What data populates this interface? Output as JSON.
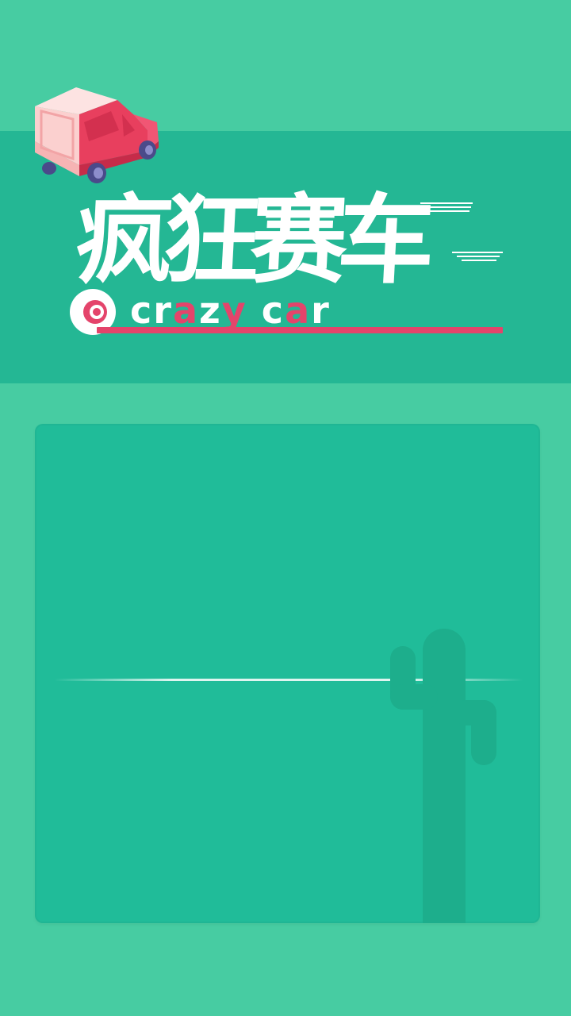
{
  "title": {
    "chinese": "疯狂赛车",
    "english_parts": [
      {
        "text": "cr",
        "color": "#ffffff"
      },
      {
        "text": "a",
        "color": "#e4446b"
      },
      {
        "text": "z",
        "color": "#ffffff"
      },
      {
        "text": "y",
        "color": "#e4446b"
      },
      {
        "text": " c",
        "color": "#ffffff"
      },
      {
        "text": "a",
        "color": "#e4446b"
      },
      {
        "text": "r",
        "color": "#ffffff"
      }
    ]
  },
  "icons": {
    "car": "pink-car-icon",
    "wheel": "wheel-icon",
    "cactus": "cactus-icon"
  },
  "colors": {
    "background": "#47cca2",
    "banner": "#24b794",
    "panel": "#20bc99",
    "accent": "#e4446b",
    "cactus": "#1dae8c"
  }
}
